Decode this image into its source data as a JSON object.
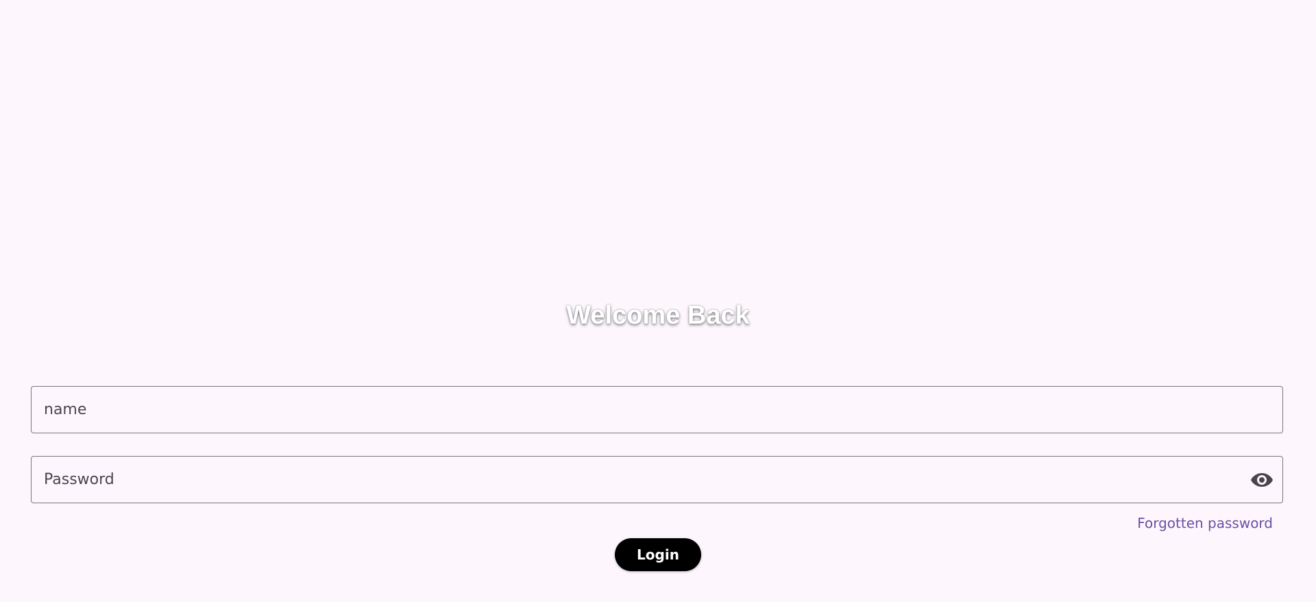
{
  "login": {
    "title": "Welcome Back",
    "name_field": {
      "value": "",
      "placeholder": "name"
    },
    "password_field": {
      "value": "",
      "placeholder": "Password",
      "toggle_icon": "eye-icon"
    },
    "forgot_password_label": "Forgotten password",
    "login_button_label": "Login"
  },
  "colors": {
    "background": "#fdf7fd",
    "link": "#6750a4",
    "button": "#000000",
    "border": "#7a7580"
  }
}
